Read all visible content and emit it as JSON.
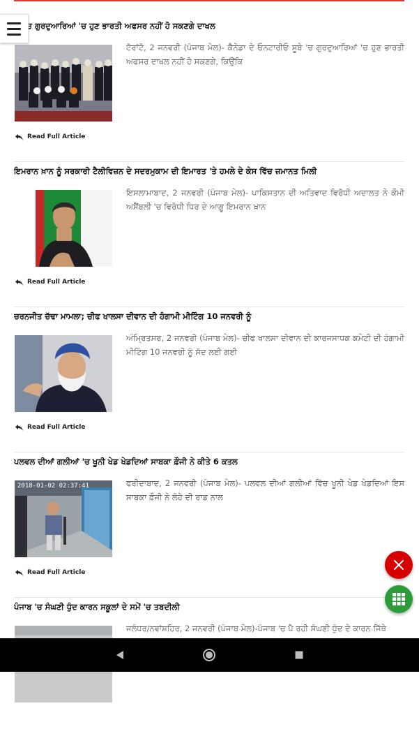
{
  "articles": [
    {
      "headline": "ਡਾ 'ਚ ਗੁਰਦੁਆਰਿਆਂ 'ਚ ਹੁਣ ਭਾਰਤੀ ਅਫਸਰ ਨਹੀਂ ਹੋ ਸਕਣਗੇ ਦਾਖਲ",
      "excerpt": "ਟੋਰਾਂਟੋ, 2 ਜਨਵਰੀ (ਪੰਜਾਬ ਮੇਲ)- ਕੈਨੇਡਾ ਦੇ ਓਨਟਾਰੀਓ ਸੂਬੇ 'ਚ ਗੁਰਦੁਆਰਿਆਂ 'ਚ ਹੁਣ ਭਾਰਤੀ ਅਫਸਰ ਦਾਖਲ ਨਹੀਂ ਹੋ ਸਕਣਗੇ, ਕਿਉਂਕਿ",
      "read_more": "Read Full Article"
    },
    {
      "headline": "ਇਮਰਾਨ ਖ਼ਾਨ ਨੂੰ ਸਰਕਾਰੀ ਟੈਲੀਵਿਜ਼ਨ ਦੇ ਸਦਰਮੁਕਾਮ ਦੀ ਇਮਾਰਤ 'ਤੇ ਹਮਲੇ ਦੇ ਕੇਸ ਵਿੱਚ ਜ਼ਮਾਨਤ ਮਿਲੀ",
      "excerpt": "ਇਸਲਾਮਾਬਾਦ, 2 ਜਨਵਰੀ (ਪੰਜਾਬ ਮੇਲ)- ਪਾਕਿਸਤਾਨ ਦੀ ਅਤਿਵਾਦ ਵਿਰੋਧੀ ਅਦਾਲਤ ਨੇ ਕੌਮੀ ਅਸੈਂਬਲੀ 'ਚ ਵਿਰੋਧੀ ਧਿਰ ਦੇ ਆਗੂ ਇਮਰਾਨ ਖ਼ਾਨ",
      "read_more": "Read Full Article"
    },
    {
      "headline": "ਚਰਨਜੀਤ ਚੱਢਾ ਮਾਮਲਾ; ਚੀਫ ਖਾਲਸਾ ਦੀਵਾਨ ਦੀ ਹੰਗਾਮੀ ਮੀਟਿੰਗ 10 ਜਨਵਰੀ ਨੂੰ",
      "excerpt": "ਅੰਮ੍ਰਿਤਸਰ, 2 ਜਨਵਰੀ (ਪੰਜਾਬ ਮੇਲ)- ਚੀਫ ਖਾਲਸਾ ਦੀਵਾਨ ਦੀ ਕਾਰਜਸਾਧਕ ਕਮੇਟੀ ਦੀ ਹੰਗਾਮੀ ਮੀਟਿੰਗ 10 ਜਨਵਰੀ ਨੂੰ ਸੱਦ ਲਈ ਗਈ",
      "read_more": "Read Full Article"
    },
    {
      "headline": "ਪਲਵਲ ਦੀਆਂ ਗਲੀਆਂ 'ਚ ਖੂਨੀ ਖੇਡ ਖੇਡਦਿਆਂ ਸਾਬਕਾ ਫ਼ੌਜੀ ਨੇ ਕੀਤੇ 6 ਕਤਲ",
      "excerpt": "ਫਰੀਦਾਬਾਦ, 2 ਜਨਵਰੀ (ਪੰਜਾਬ ਮੇਲ)- ਪਲਵਲ ਦੀਆਂ ਗਲੀਆਂ ਵਿੱਚ ਖੂਨੀ ਖੇਡ ਖੇਡਦਿਆਂ ਇਸ ਸਾਬਕਾ ਫ਼ੌਜੀ ਨੇ ਲੋਹੇ ਦੀ ਰਾਡ ਨਾਲ",
      "read_more": "Read Full Article",
      "thumb_stamp": "2018-01-02 02:37:41"
    },
    {
      "headline": "ਪੰਜਾਬ 'ਚ ਸੰਘਣੀ ਧੁੰਦ ਕਾਰਨ ਸਕੂਲਾਂ ਦੇ ਸਮੇਂ 'ਚ ਤਬਦੀਲੀ",
      "excerpt": "ਜਲੰਧਰ/ਨਵਾਂਸ਼ਹਿਰ, 2 ਜਨਵਰੀ (ਪੰਜਾਬ ਮੇਲ)-ਪੰਜਾਬ 'ਚ ਪੈ ਰਹੀ ਸੰਘਣੀ ਧੁੰਦ ਦੇ ਕਾਰਨ ਜਿੱਥੇ"
    }
  ],
  "colors": {
    "accent_red": "#d50000",
    "fab_green": "#2e9b3a",
    "navbar": "#000000"
  },
  "icons": {
    "menu": "hamburger-icon",
    "read_more": "reply-arrow-icon",
    "fab_close": "close-icon",
    "fab_grid": "grid-icon",
    "nav_back": "back-icon",
    "nav_home": "home-icon",
    "nav_recents": "recents-icon"
  }
}
